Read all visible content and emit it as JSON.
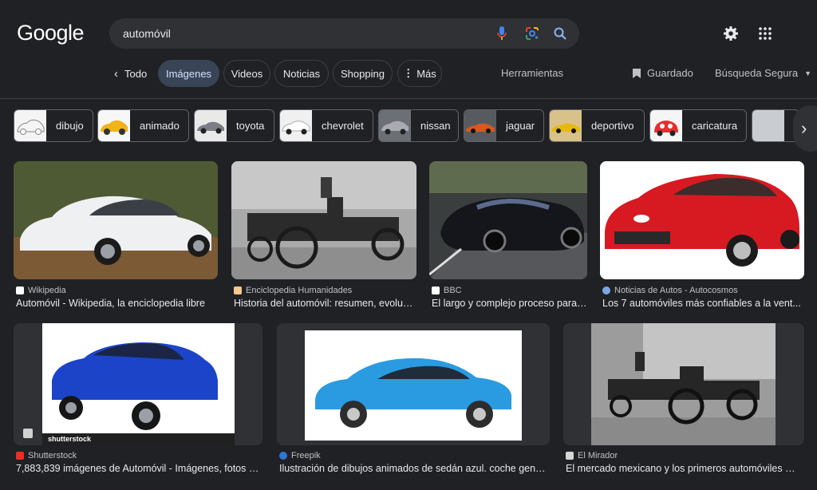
{
  "logo": "Google",
  "search": {
    "query": "automóvil"
  },
  "tabs": {
    "back": "Todo",
    "items": [
      {
        "label": "Imágenes",
        "active": true
      },
      {
        "label": "Videos",
        "active": false
      },
      {
        "label": "Noticias",
        "active": false
      },
      {
        "label": "Shopping",
        "active": false
      },
      {
        "label": "Más",
        "active": false
      }
    ],
    "tools": "Herramientas",
    "saved": "Guardado",
    "safe_search": "Búsqueda Segura"
  },
  "chips": [
    "dibujo",
    "animado",
    "toyota",
    "chevrolet",
    "nissan",
    "jaguar",
    "deportivo",
    "caricatura"
  ],
  "results": [
    {
      "source": "Wikipedia",
      "title": "Automóvil - Wikipedia, la enciclopedia libre"
    },
    {
      "source": "Enciclopedia Humanidades",
      "title": "Historia del automóvil: resumen, evoluc..."
    },
    {
      "source": "BBC",
      "title": "El largo y complejo proceso para ..."
    },
    {
      "source": "Noticias de Autos - Autocosmos",
      "title": "Los 7 automóviles más confiables a la vent..."
    },
    {
      "source": "Shutterstock",
      "title": "7,883,839 imágenes de Automóvil - Imágenes, fotos y ...",
      "watermark": "shutterstock"
    },
    {
      "source": "Freepik",
      "title": "Ilustración de dibujos animados de sedán azul. coche genér..."
    },
    {
      "source": "El Mirador",
      "title": "El mercado mexicano y los primeros automóviles — ..."
    }
  ],
  "colors": {
    "background": "#202124",
    "search_bg": "#303134",
    "active_tab": "#394457",
    "text": "#e8eaed",
    "muted": "#bdc1c6"
  }
}
